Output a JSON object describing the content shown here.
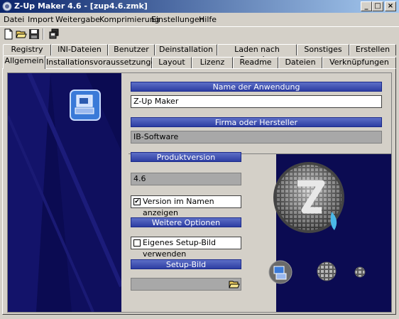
{
  "window": {
    "title": "Z-Up Maker 4.6 - [zup4.6.zmk]",
    "controls": [
      "_",
      "□",
      "×"
    ]
  },
  "menu": [
    "Datei",
    "Import",
    "Weitergabe",
    "Komprimierung",
    "Einstellungen",
    "Hilfe"
  ],
  "toolbar": {
    "icons": [
      "new-file-icon",
      "open-folder-icon",
      "save-disk-icon",
      "copy-icon"
    ]
  },
  "tabs_back": [
    "Registry",
    "INI-Dateien",
    "Benutzer",
    "Deinstallation",
    "Laden nach Beenden",
    "Sonstiges",
    "Erstellen"
  ],
  "tabs_front": [
    "Allgemein",
    "Installationsvoraussetzungen",
    "Layout",
    "Lizenz",
    "Readme",
    "Dateien",
    "Verknüpfungen"
  ],
  "form": {
    "app_name_header": "Name der Anwendung",
    "app_name_value": "Z-Up Maker",
    "company_header": "Firma oder Hersteller",
    "company_value": "IB-Software",
    "version_header": "Produktversion",
    "version_value": "4.6",
    "version_in_name_label": "Version im Namen anzeigen",
    "version_in_name_checked": true,
    "more_options_header": "Weitere Optionen",
    "custom_setup_image_label": "Eigenes Setup-Bild verwenden",
    "custom_setup_image_checked": false,
    "setup_image_header": "Setup-Bild",
    "setup_image_value": ""
  },
  "colors": {
    "title_start": "#0a246a",
    "title_end": "#a6caf0",
    "dark_blue": "#0b0b52",
    "header_blue": "#3a4bb0"
  }
}
